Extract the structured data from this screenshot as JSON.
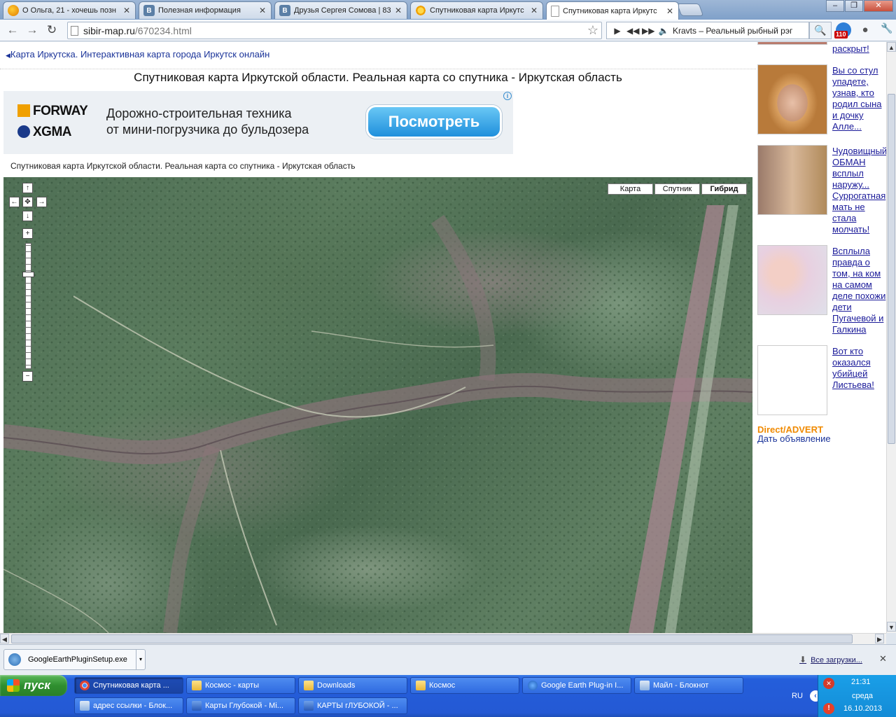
{
  "browser": {
    "tabs": [
      {
        "title": "О Ольга, 21 - хочешь позн",
        "icon": "odnoklassniki-icon",
        "active": false
      },
      {
        "title": "Полезная информация",
        "icon": "vk-icon",
        "active": false
      },
      {
        "title": "Друзья Сергея Сомова | 83",
        "icon": "vk-icon",
        "active": false
      },
      {
        "title": "Спутниковая карта Иркутс",
        "icon": "sun-icon",
        "active": false
      },
      {
        "title": "Спутниковая карта Иркутс",
        "icon": "page-icon",
        "active": true
      }
    ],
    "window_controls": {
      "minimize": "–",
      "maximize": "❐",
      "close": "✕"
    },
    "url_host": "sibir-map.ru",
    "url_path": "/670234.html",
    "player": {
      "track": "Kravts – Реальный рыбный рэг"
    },
    "extension_count": "110"
  },
  "page": {
    "back_link": "Карта Иркутска. Интерактивная карта города Иркутск онлайн",
    "title": "Спутниковая карта Иркутской области. Реальная карта со спутника - Иркутская область",
    "ad": {
      "brand1": "FORWAY",
      "brand2": "XGMA",
      "line1": "Дорожно-строительная техника",
      "line2": "от мини-погрузчика до бульдозера",
      "cta": "Посмотреть",
      "info": "i"
    },
    "map_caption": "Спутниковая карта Иркутской области. Реальная карта со спутника - Иркутская область",
    "map": {
      "types": [
        {
          "label": "Карта",
          "selected": false
        },
        {
          "label": "Спутник",
          "selected": false
        },
        {
          "label": "Гибрид",
          "selected": true
        }
      ],
      "zoom_level_fraction": 0.24
    }
  },
  "sidebar": {
    "items": [
      {
        "text": "раскрыт!"
      },
      {
        "text": "Вы со стул упадете, узнав, кто родил сына и дочку Алле..."
      },
      {
        "text": "Чудовищный ОБМАН всплыл наружу... Суррогатная мать не стала молчать!"
      },
      {
        "text": "Всплыла правда о том, на ком на самом деле похожи дети Пугачевой и Галкина"
      },
      {
        "text": "Вот кто оказался убийцей Листьева!"
      }
    ],
    "direct_advert": "Direct/ADVERT",
    "place_ad": "Дать объявление"
  },
  "downloads": {
    "file": "GoogleEarthPluginSetup.exe",
    "show_all": "Все загрузки..."
  },
  "taskbar": {
    "start": "пуск",
    "tasks_row1": [
      {
        "label": "Спутниковая карта ...",
        "icon": "chrome-icon",
        "active": true
      },
      {
        "label": "Космос - карты",
        "icon": "folder-icon",
        "active": false
      },
      {
        "label": "Downloads",
        "icon": "folder-icon",
        "active": false
      },
      {
        "label": "Космос",
        "icon": "folder-icon",
        "active": false
      },
      {
        "label": "Google Earth Plug-in I...",
        "icon": "google-earth-icon",
        "active": false
      },
      {
        "label": "Майл - Блокнот",
        "icon": "notepad-icon",
        "active": false
      }
    ],
    "tasks_row2": [
      {
        "label": "адрес ссылки - Блок...",
        "icon": "notepad-icon",
        "active": false
      },
      {
        "label": "Карты Глубокой - Mi...",
        "icon": "word-icon",
        "active": false
      },
      {
        "label": "КАРТЫ гЛУБОКОЙ - ...",
        "icon": "word-icon",
        "active": false
      }
    ],
    "lang": "RU",
    "time": "21:31",
    "day": "среда",
    "date": "16.10.2013"
  }
}
